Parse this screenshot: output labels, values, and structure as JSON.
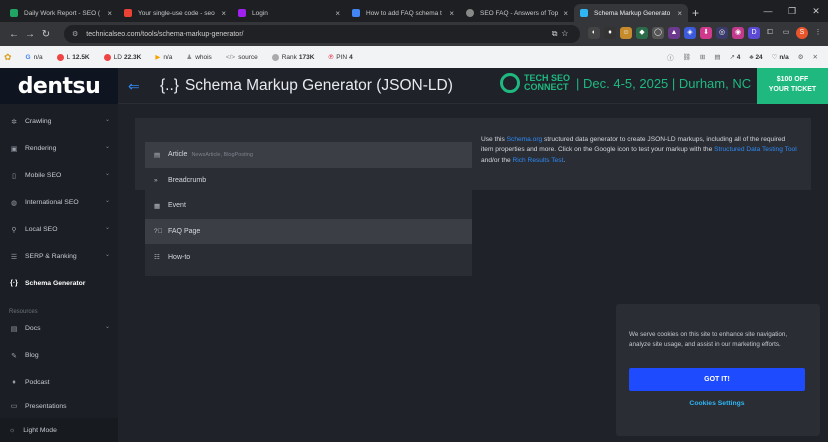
{
  "browser": {
    "tabs": [
      {
        "title": "Daily Work Report - SEO (",
        "color": "#1fa463"
      },
      {
        "title": "Your single-use code - seo",
        "color": "#ea4335"
      },
      {
        "title": "Login",
        "color": "#a020f0"
      },
      {
        "title": "How to add FAQ schema t",
        "color": "#4285f4"
      },
      {
        "title": "SEO FAQ - Answers of Top",
        "color": "#888888"
      },
      {
        "title": "Schema Markup Generato",
        "color": "#2fb6f5"
      }
    ],
    "url": "technicalseo.com/tools/schema-markup-generator/"
  },
  "seobar": {
    "g": "n/a",
    "l": "12.5K",
    "ld": "22.3K",
    "i": "n/a",
    "whois": "whois",
    "source": "source",
    "rank_label": "Rank",
    "rank": "173K",
    "pin_label": "PIN",
    "pin": "4",
    "r1": "4",
    "r2": "24",
    "r3": "n/a"
  },
  "header": {
    "logo": "dentsu",
    "title": "Schema Markup Generator (JSON-LD)",
    "promo_line1": "TECH SEO",
    "promo_line2": "CONNECT",
    "promo_date": "| Dec. 4-5, 2025 | Durham, NC",
    "ticket_line1": "$100 OFF",
    "ticket_line2": "YOUR TICKET"
  },
  "sidebar": {
    "items": [
      {
        "label": "Crawling"
      },
      {
        "label": "Rendering"
      },
      {
        "label": "Mobile SEO"
      },
      {
        "label": "International SEO"
      },
      {
        "label": "Local SEO"
      },
      {
        "label": "SERP & Ranking"
      },
      {
        "label": "Schema Generator"
      }
    ],
    "resources_label": "Resources",
    "resources": [
      {
        "label": "Docs"
      },
      {
        "label": "Blog"
      },
      {
        "label": "Podcast"
      },
      {
        "label": "Presentations"
      }
    ],
    "light_mode": "Light Mode"
  },
  "types": [
    {
      "label": "Article",
      "sub": "NewsArticle, BlogPosting"
    },
    {
      "label": "Breadcrumb",
      "sub": ""
    },
    {
      "label": "Event",
      "sub": ""
    },
    {
      "label": "FAQ Page",
      "sub": ""
    },
    {
      "label": "How-to",
      "sub": ""
    }
  ],
  "description": {
    "p1": "Use this ",
    "link1": "Schema.org",
    "p2": " structured data generator to create JSON-LD markups, including all of the required item properties and more. Click on the Google icon to test your markup with the ",
    "link2": "Structured Data Testing Tool",
    "p3": " and/or the ",
    "link3": "Rich Results Test",
    "p4": "."
  },
  "cookie": {
    "text": "We serve cookies on this site to enhance site navigation, analyze site usage, and assist in our marketing efforts.",
    "accept": "GOT IT!",
    "settings": "Cookies Settings"
  }
}
